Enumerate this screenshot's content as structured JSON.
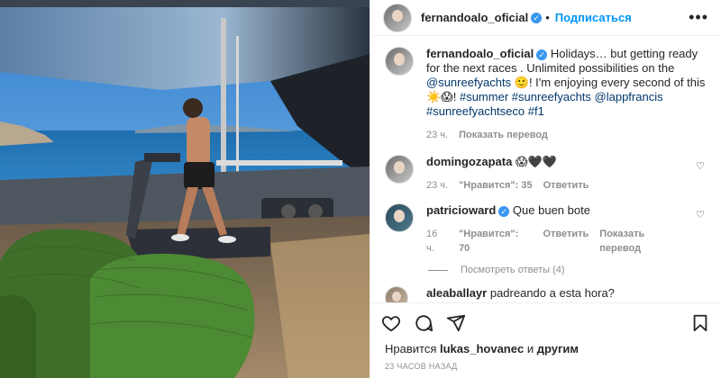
{
  "header": {
    "username": "fernandoalo_oficial",
    "follow_label": "Подписаться",
    "more_icon": "•••"
  },
  "caption": {
    "username": "fernandoalo_oficial",
    "text_1": "Holidays… but getting ready for the next races . Unlimited possibilities on the ",
    "tag_1": "@sunreefyachts",
    "text_2": " 🙂! I'm enjoying every second of this ☀️😱! ",
    "tags_2": "#summer #sunreefyachts @lappfrancis #sunreefyachtseco #f1",
    "time": "23 ч.",
    "translate": "Показать перевод"
  },
  "comments": [
    {
      "username": "domingozapata",
      "text": "😱🖤🖤",
      "time": "23 ч.",
      "likes": "\"Нравится\": 35",
      "reply": "Ответить",
      "translate": ""
    },
    {
      "username": "patricioward",
      "text": "Que buen bote",
      "time": "16 ч.",
      "likes": "\"Нравится\": 70",
      "reply": "Ответить",
      "translate": "Показать перевод",
      "view_replies": "Посмотреть ответы (4)"
    },
    {
      "username": "aleaballayr",
      "text": "padreando a esta hora?"
    }
  ],
  "likes": {
    "prefix": "Нравится ",
    "user": "lukas_hovanec",
    "suffix": " и ",
    "others": "другим"
  },
  "timestamp": "23 ЧАСОВ НАЗАД",
  "icons": [
    "heart-icon",
    "comment-icon",
    "share-icon",
    "bookmark-icon"
  ]
}
